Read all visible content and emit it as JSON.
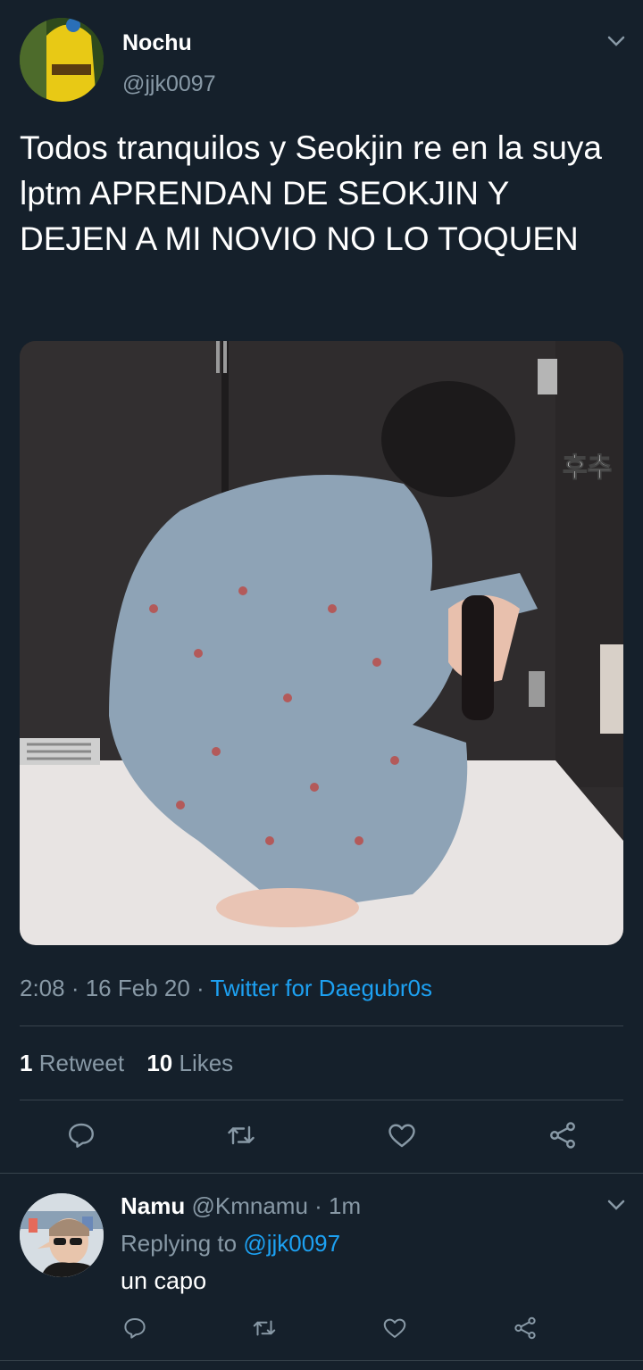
{
  "colors": {
    "background": "#15202b",
    "muted": "#8899a6",
    "accent": "#1da1f2",
    "divider": "#38444d"
  },
  "tweet": {
    "author_name": "Nochu",
    "author_handle": "@jjk0097",
    "text": "Todos tranquilos y Seokjin re en la suya lptm APRENDAN DE SEOKJIN Y DEJEN A MI NOVIO NO LO TOQUEN",
    "media_caption": "후추",
    "time": "2:08",
    "date": "16 Feb 20",
    "source": "Twitter for Daegubr0s",
    "retweet_count": "1",
    "retweet_label": "Retweet",
    "like_count": "10",
    "like_label": "Likes",
    "icons": [
      "chevron-down-icon",
      "reply-icon",
      "retweet-icon",
      "like-icon",
      "share-icon"
    ]
  },
  "reply": {
    "author_name": "Namu",
    "author_handle": "@Kmnamu",
    "age": "1m",
    "replying_prefix": "Replying to",
    "replying_to": "@jjk0097",
    "text": "un capo"
  }
}
